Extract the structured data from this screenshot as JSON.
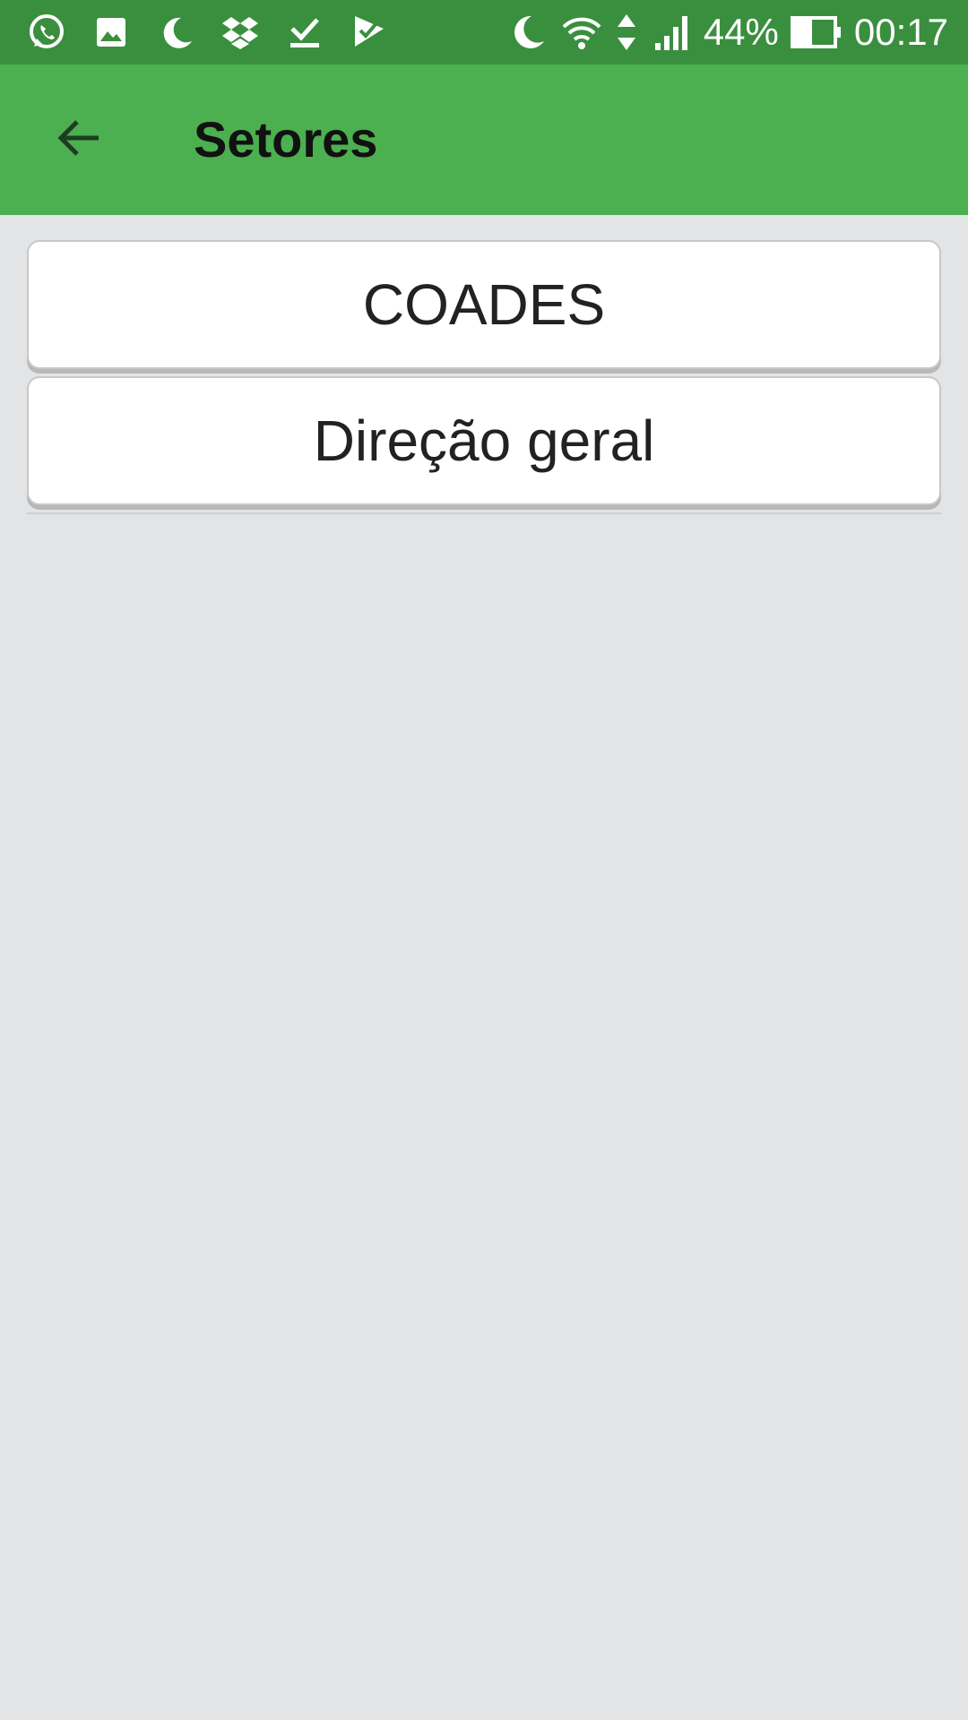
{
  "status_bar": {
    "battery": "44%",
    "time": "00:17",
    "left_icons": [
      "whatsapp-icon",
      "image-icon",
      "moon-icon",
      "dropbox-icon",
      "download-check-icon",
      "flag-check-icon"
    ],
    "right_icons": [
      "moon-icon",
      "wifi-icon",
      "data-arrows-icon",
      "signal-icon",
      "battery-icon"
    ]
  },
  "app_bar": {
    "title": "Setores",
    "back_icon": "arrow-back-icon",
    "background_color": "#4caf50",
    "status_color": "#3a8f3f"
  },
  "list": {
    "items": [
      {
        "label": "COADES"
      },
      {
        "label": "Direção geral"
      }
    ]
  }
}
